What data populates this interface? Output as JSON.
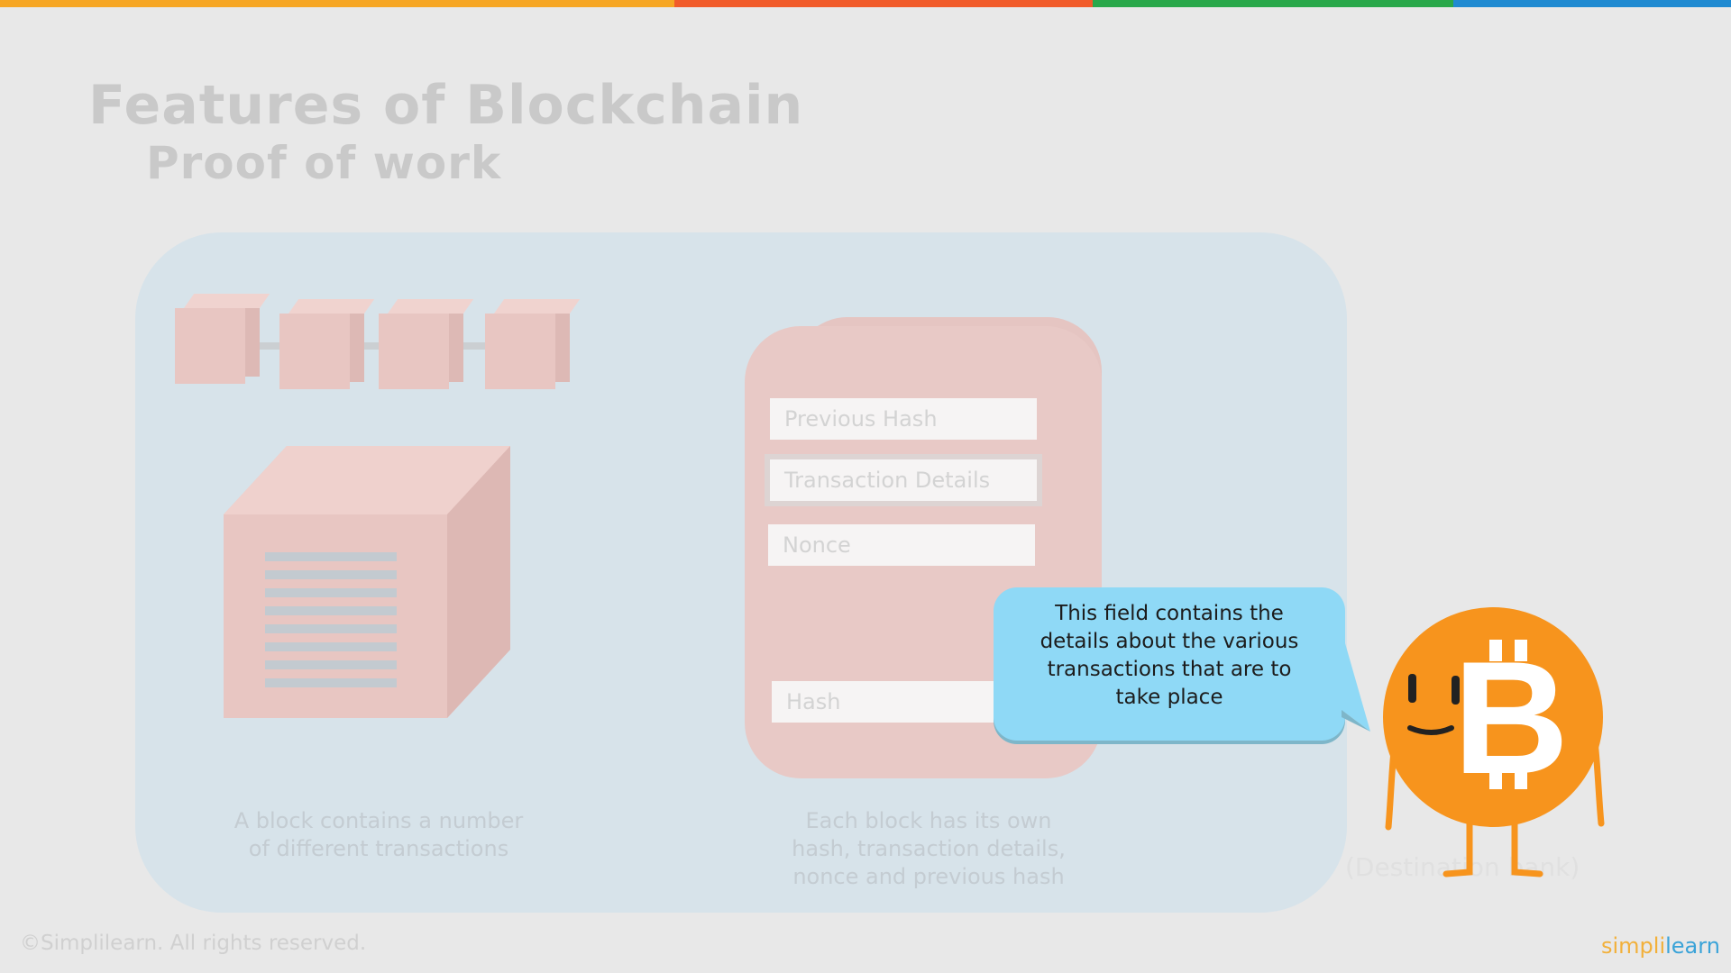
{
  "slide": {
    "title": "Features of Blockchain",
    "subtitle": "Proof of work"
  },
  "colors": {
    "stripe": [
      "#f6a623",
      "#f15b2a",
      "#29a84a",
      "#1f8ad1"
    ],
    "bubble": "#8fd9f6",
    "mascot": "#f7941d"
  },
  "left_panel": {
    "caption_line1": "A block contains a number",
    "caption_line2": "of different transactions"
  },
  "block_card": {
    "fields": [
      "Previous Hash",
      "Transaction Details",
      "Nonce",
      "Hash"
    ],
    "caption_line1": "Each block has its own",
    "caption_line2": "hash, transaction details,",
    "caption_line3": "nonce and previous hash"
  },
  "callout": {
    "line1": "This field contains the",
    "line2": "details about the various",
    "line3": "transactions that are to",
    "line4": "take place"
  },
  "destination_label": "(Destination bank)",
  "footer": {
    "copyright": "©Simplilearn. All rights reserved.",
    "logo_part1": "simpli",
    "logo_part2": "learn"
  }
}
